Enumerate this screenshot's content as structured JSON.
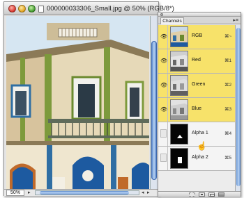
{
  "document_window": {
    "title": "000000033306_Small.jpg @ 50% (RGB/8*)",
    "zoom_value": "50%",
    "image_subject": "building-photo"
  },
  "channels_panel": {
    "tab_label": "Channels",
    "channels": [
      {
        "name": "RGB",
        "shortcut": "⌘~",
        "visible": true,
        "selected": true,
        "thumbnail": "color-photo"
      },
      {
        "name": "Red",
        "shortcut": "⌘1",
        "visible": true,
        "selected": true,
        "thumbnail": "grayscale-photo"
      },
      {
        "name": "Green",
        "shortcut": "⌘2",
        "visible": true,
        "selected": true,
        "thumbnail": "grayscale-photo"
      },
      {
        "name": "Blue",
        "shortcut": "⌘3",
        "visible": true,
        "selected": true,
        "thumbnail": "grayscale-photo"
      },
      {
        "name": "Alpha 1",
        "shortcut": "⌘4",
        "visible": false,
        "selected": false,
        "thumbnail": "alpha-mask"
      },
      {
        "name": "Alpha 2",
        "shortcut": "⌘5",
        "visible": false,
        "selected": false,
        "thumbnail": "alpha-mask"
      }
    ],
    "footer_buttons": [
      "load-selection-icon",
      "save-selection-icon",
      "new-channel-icon",
      "delete-channel-icon"
    ]
  },
  "icons": {
    "eye": "👁",
    "menu_arrow": "▸",
    "hand_cursor": "☝"
  },
  "colors": {
    "selected_row": "#f7e26a",
    "scroll_blue": "#5d8ccf"
  }
}
